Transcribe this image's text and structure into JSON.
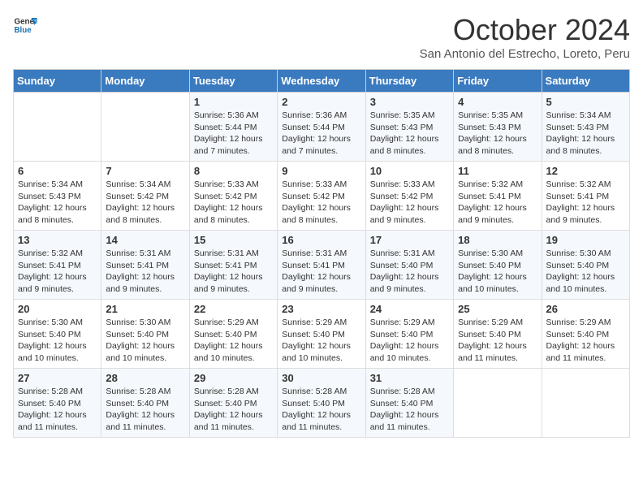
{
  "logo": {
    "line1": "General",
    "line2": "Blue"
  },
  "header": {
    "month": "October 2024",
    "location": "San Antonio del Estrecho, Loreto, Peru"
  },
  "days_of_week": [
    "Sunday",
    "Monday",
    "Tuesday",
    "Wednesday",
    "Thursday",
    "Friday",
    "Saturday"
  ],
  "weeks": [
    [
      {
        "num": "",
        "info": ""
      },
      {
        "num": "",
        "info": ""
      },
      {
        "num": "1",
        "info": "Sunrise: 5:36 AM\nSunset: 5:44 PM\nDaylight: 12 hours and 7 minutes."
      },
      {
        "num": "2",
        "info": "Sunrise: 5:36 AM\nSunset: 5:44 PM\nDaylight: 12 hours and 7 minutes."
      },
      {
        "num": "3",
        "info": "Sunrise: 5:35 AM\nSunset: 5:43 PM\nDaylight: 12 hours and 8 minutes."
      },
      {
        "num": "4",
        "info": "Sunrise: 5:35 AM\nSunset: 5:43 PM\nDaylight: 12 hours and 8 minutes."
      },
      {
        "num": "5",
        "info": "Sunrise: 5:34 AM\nSunset: 5:43 PM\nDaylight: 12 hours and 8 minutes."
      }
    ],
    [
      {
        "num": "6",
        "info": "Sunrise: 5:34 AM\nSunset: 5:43 PM\nDaylight: 12 hours and 8 minutes."
      },
      {
        "num": "7",
        "info": "Sunrise: 5:34 AM\nSunset: 5:42 PM\nDaylight: 12 hours and 8 minutes."
      },
      {
        "num": "8",
        "info": "Sunrise: 5:33 AM\nSunset: 5:42 PM\nDaylight: 12 hours and 8 minutes."
      },
      {
        "num": "9",
        "info": "Sunrise: 5:33 AM\nSunset: 5:42 PM\nDaylight: 12 hours and 8 minutes."
      },
      {
        "num": "10",
        "info": "Sunrise: 5:33 AM\nSunset: 5:42 PM\nDaylight: 12 hours and 9 minutes."
      },
      {
        "num": "11",
        "info": "Sunrise: 5:32 AM\nSunset: 5:41 PM\nDaylight: 12 hours and 9 minutes."
      },
      {
        "num": "12",
        "info": "Sunrise: 5:32 AM\nSunset: 5:41 PM\nDaylight: 12 hours and 9 minutes."
      }
    ],
    [
      {
        "num": "13",
        "info": "Sunrise: 5:32 AM\nSunset: 5:41 PM\nDaylight: 12 hours and 9 minutes."
      },
      {
        "num": "14",
        "info": "Sunrise: 5:31 AM\nSunset: 5:41 PM\nDaylight: 12 hours and 9 minutes."
      },
      {
        "num": "15",
        "info": "Sunrise: 5:31 AM\nSunset: 5:41 PM\nDaylight: 12 hours and 9 minutes."
      },
      {
        "num": "16",
        "info": "Sunrise: 5:31 AM\nSunset: 5:41 PM\nDaylight: 12 hours and 9 minutes."
      },
      {
        "num": "17",
        "info": "Sunrise: 5:31 AM\nSunset: 5:40 PM\nDaylight: 12 hours and 9 minutes."
      },
      {
        "num": "18",
        "info": "Sunrise: 5:30 AM\nSunset: 5:40 PM\nDaylight: 12 hours and 10 minutes."
      },
      {
        "num": "19",
        "info": "Sunrise: 5:30 AM\nSunset: 5:40 PM\nDaylight: 12 hours and 10 minutes."
      }
    ],
    [
      {
        "num": "20",
        "info": "Sunrise: 5:30 AM\nSunset: 5:40 PM\nDaylight: 12 hours and 10 minutes."
      },
      {
        "num": "21",
        "info": "Sunrise: 5:30 AM\nSunset: 5:40 PM\nDaylight: 12 hours and 10 minutes."
      },
      {
        "num": "22",
        "info": "Sunrise: 5:29 AM\nSunset: 5:40 PM\nDaylight: 12 hours and 10 minutes."
      },
      {
        "num": "23",
        "info": "Sunrise: 5:29 AM\nSunset: 5:40 PM\nDaylight: 12 hours and 10 minutes."
      },
      {
        "num": "24",
        "info": "Sunrise: 5:29 AM\nSunset: 5:40 PM\nDaylight: 12 hours and 10 minutes."
      },
      {
        "num": "25",
        "info": "Sunrise: 5:29 AM\nSunset: 5:40 PM\nDaylight: 12 hours and 11 minutes."
      },
      {
        "num": "26",
        "info": "Sunrise: 5:29 AM\nSunset: 5:40 PM\nDaylight: 12 hours and 11 minutes."
      }
    ],
    [
      {
        "num": "27",
        "info": "Sunrise: 5:28 AM\nSunset: 5:40 PM\nDaylight: 12 hours and 11 minutes."
      },
      {
        "num": "28",
        "info": "Sunrise: 5:28 AM\nSunset: 5:40 PM\nDaylight: 12 hours and 11 minutes."
      },
      {
        "num": "29",
        "info": "Sunrise: 5:28 AM\nSunset: 5:40 PM\nDaylight: 12 hours and 11 minutes."
      },
      {
        "num": "30",
        "info": "Sunrise: 5:28 AM\nSunset: 5:40 PM\nDaylight: 12 hours and 11 minutes."
      },
      {
        "num": "31",
        "info": "Sunrise: 5:28 AM\nSunset: 5:40 PM\nDaylight: 12 hours and 11 minutes."
      },
      {
        "num": "",
        "info": ""
      },
      {
        "num": "",
        "info": ""
      }
    ]
  ]
}
